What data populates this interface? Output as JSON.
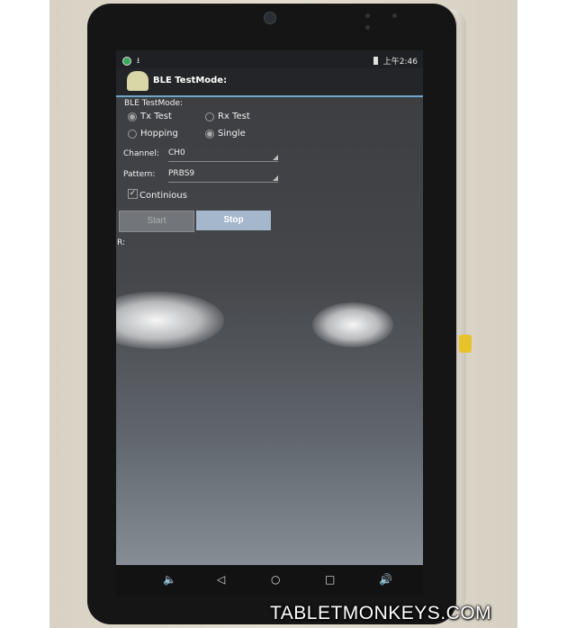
{
  "status_bar": {
    "left_icons": [
      "sync-icon",
      "download-icon"
    ],
    "right_icons": [
      "battery-icon"
    ],
    "time": "上午2:46"
  },
  "action_bar": {
    "title": "BLE TestMode:"
  },
  "form": {
    "section_label": "BLE TestMode:",
    "radios": {
      "tx_test": "Tx Test",
      "rx_test": "Rx Test",
      "hopping": "Hopping",
      "single": "Single"
    },
    "channel": {
      "label": "Channel:",
      "value": "CH0"
    },
    "pattern": {
      "label": "Pattern:",
      "value": "PRBS9"
    },
    "continuous": {
      "label": "Continious",
      "checked": true
    },
    "buttons": {
      "start": "Start",
      "stop": "Stop"
    },
    "result_label": "R:"
  },
  "nav_bar": {
    "icons": [
      "volume-down-icon",
      "back-icon",
      "home-icon",
      "recents-icon",
      "volume-up-icon"
    ]
  },
  "watermark": "TABLETMONKEYS.COM",
  "colors": {
    "accent_line": "#6fa6c9",
    "stop_button": "#a5b7cc",
    "app_icon": "#d9d6a8"
  }
}
